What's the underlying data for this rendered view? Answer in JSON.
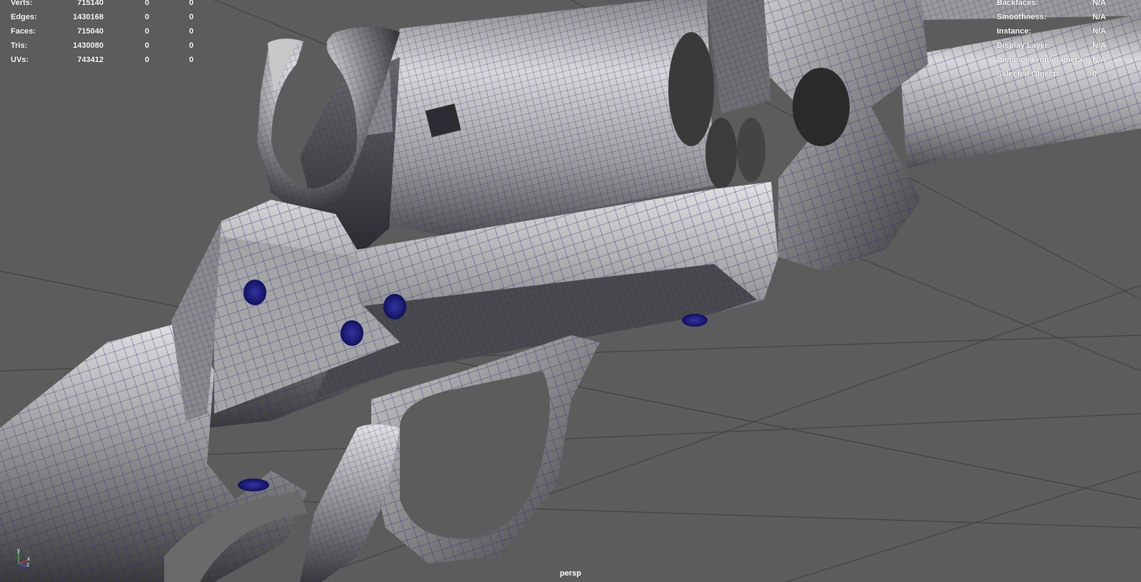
{
  "poly_count": {
    "rows": [
      {
        "label": "Verts:",
        "total": "715140",
        "selected": "0",
        "component": "0"
      },
      {
        "label": "Edges:",
        "total": "1430168",
        "selected": "0",
        "component": "0"
      },
      {
        "label": "Faces:",
        "total": "715040",
        "selected": "0",
        "component": "0"
      },
      {
        "label": "Tris:",
        "total": "1430080",
        "selected": "0",
        "component": "0"
      },
      {
        "label": "UVs:",
        "total": "743412",
        "selected": "0",
        "component": "0"
      }
    ]
  },
  "object_details": {
    "rows": [
      {
        "label": "Backfaces:",
        "value": "N/A"
      },
      {
        "label": "Smoothness:",
        "value": "N/A"
      },
      {
        "label": "Instance:",
        "value": "N/A"
      },
      {
        "label": "Display Layer:",
        "value": "N/A"
      },
      {
        "label": "Distance From Camera:",
        "value": "N/A"
      },
      {
        "label": "Selected Objects:",
        "value": "0"
      }
    ]
  },
  "viewport": {
    "camera": "persp",
    "axis_labels": {
      "y": "y",
      "x": "x",
      "z": "z"
    },
    "colors": {
      "background": "#5c5c5c",
      "grid": "#3e3e3e",
      "wireframe": "#1f1f8f",
      "surface_light": "#d8d8d8",
      "surface_dark": "#2e2e2e",
      "axis_x": "#d03030",
      "axis_y": "#30c030",
      "axis_z": "#3060e0"
    }
  }
}
